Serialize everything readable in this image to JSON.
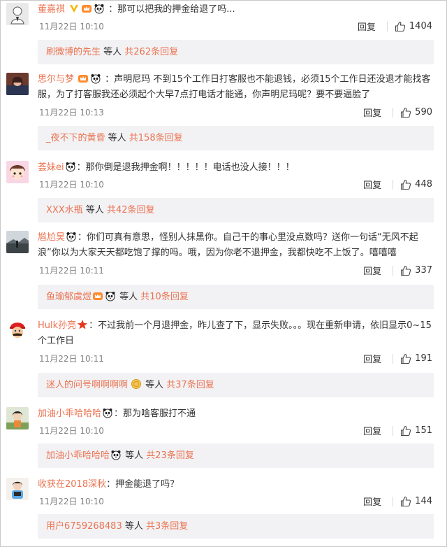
{
  "comments": [
    {
      "username": "董嘉祺",
      "badges": [
        "gold-v-icon",
        "vip-crown-icon",
        "panda-emoji-icon"
      ],
      "text": "：那可以把我的押金给退了吗...",
      "date": "11月22日 10:10",
      "reply_label": "回复",
      "likes": "1404",
      "sub": {
        "name": "刷微博的先生",
        "badge": "",
        "mid": " 等人 ",
        "count": "共262条回复"
      }
    },
    {
      "username": "思尔与梦",
      "badges": [
        "vip-crown-icon",
        "panda-emoji-icon"
      ],
      "text": "：声明尼玛 不到15个工作日打客服也不能退钱，必须15个工作日还没退才能找客服，为了打客服我还必须起个大早7点打电话才能通，你声明尼玛呢？要不要逼脸了",
      "date": "11月22日 10:13",
      "reply_label": "回复",
      "likes": "590",
      "sub": {
        "name": "_夜不下的黄昏",
        "badge": "",
        "mid": " 等人 ",
        "count": "共158条回复"
      }
    },
    {
      "username": "荟妹ei",
      "badges": [
        "panda-emoji-icon"
      ],
      "text": "：那你倒是退我押金啊！！！！！电话也没人接！！！",
      "date": "11月22日 10:10",
      "reply_label": "回复",
      "likes": "448",
      "sub": {
        "name": "XXX水瓶",
        "badge": "",
        "mid": " 等人 ",
        "count": "共42条回复"
      }
    },
    {
      "username": "尴尬昊",
      "badges": [
        "panda-emoji-icon"
      ],
      "text": "：你们可真有意思，怪别人抹黑你。自己干的事心里没点数吗？送你一句话“无风不起浪”你以为大家天天都吃饱了撑的吗。哦，因为你老不退押金，我都快吃不上饭了。嘻嘻嘻",
      "date": "11月22日 10:11",
      "reply_label": "回复",
      "likes": "337",
      "sub": {
        "name": "鱼瑜郁虞煜",
        "badge": "vip-panda",
        "mid": " 等人 ",
        "count": "共10条回复"
      }
    },
    {
      "username": "Hulk孙亮",
      "badges": [
        "red-star-icon"
      ],
      "text": "：不过我前一个月退押金，昨儿查了下，显示失败。。。现在重新申请，依旧显示0~15个工作日",
      "date": "11月22日 10:11",
      "reply_label": "回复",
      "likes": "191",
      "sub": {
        "name": "迷人的问号啊啊啊啊",
        "badge": "medal",
        "mid": " 等人 ",
        "count": "共37条回复"
      }
    },
    {
      "username": "加油小乖哈哈哈",
      "badges": [
        "panda-emoji-icon"
      ],
      "text": "：那为啥客服打不通",
      "date": "11月22日 10:10",
      "reply_label": "回复",
      "likes": "151",
      "sub": {
        "name": "加油小乖哈哈哈",
        "badge": "panda",
        "mid": " 等人 ",
        "count": "共23条回复"
      }
    },
    {
      "username": "收获在2018深秋",
      "badges": [],
      "text": "：押金能退了吗？",
      "date": "11月22日 10:10",
      "reply_label": "回复",
      "likes": "144",
      "sub": {
        "name": "用户6759268483",
        "badge": "",
        "mid": " 等人 ",
        "count": "共3条回复"
      }
    }
  ],
  "colors": {
    "username": "#eb7350",
    "text": "#333333",
    "date": "#808080",
    "sub_bg": "#f2f2f5"
  }
}
